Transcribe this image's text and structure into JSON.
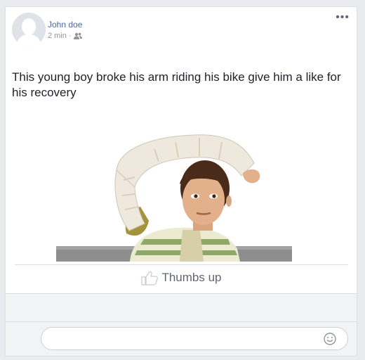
{
  "post": {
    "author": "John doe",
    "timestamp": "2 min",
    "separator": "·",
    "audience_icon": "friends-icon",
    "more_icon": "ellipsis-icon",
    "more_label": "•••",
    "text": "This young boy broke his arm riding his bike give him a like for his recovery",
    "image_icon": "photo-boy-arm-cast"
  },
  "reaction": {
    "icon": "thumbs-up-icon",
    "label": "Thumbs up"
  },
  "comment": {
    "input_value": "",
    "placeholder": "",
    "emoji_icon": "smiley-icon"
  },
  "colors": {
    "author": "#4b67a1",
    "meta": "#90949c",
    "text": "#1d2129",
    "background": "#e9ebee"
  }
}
